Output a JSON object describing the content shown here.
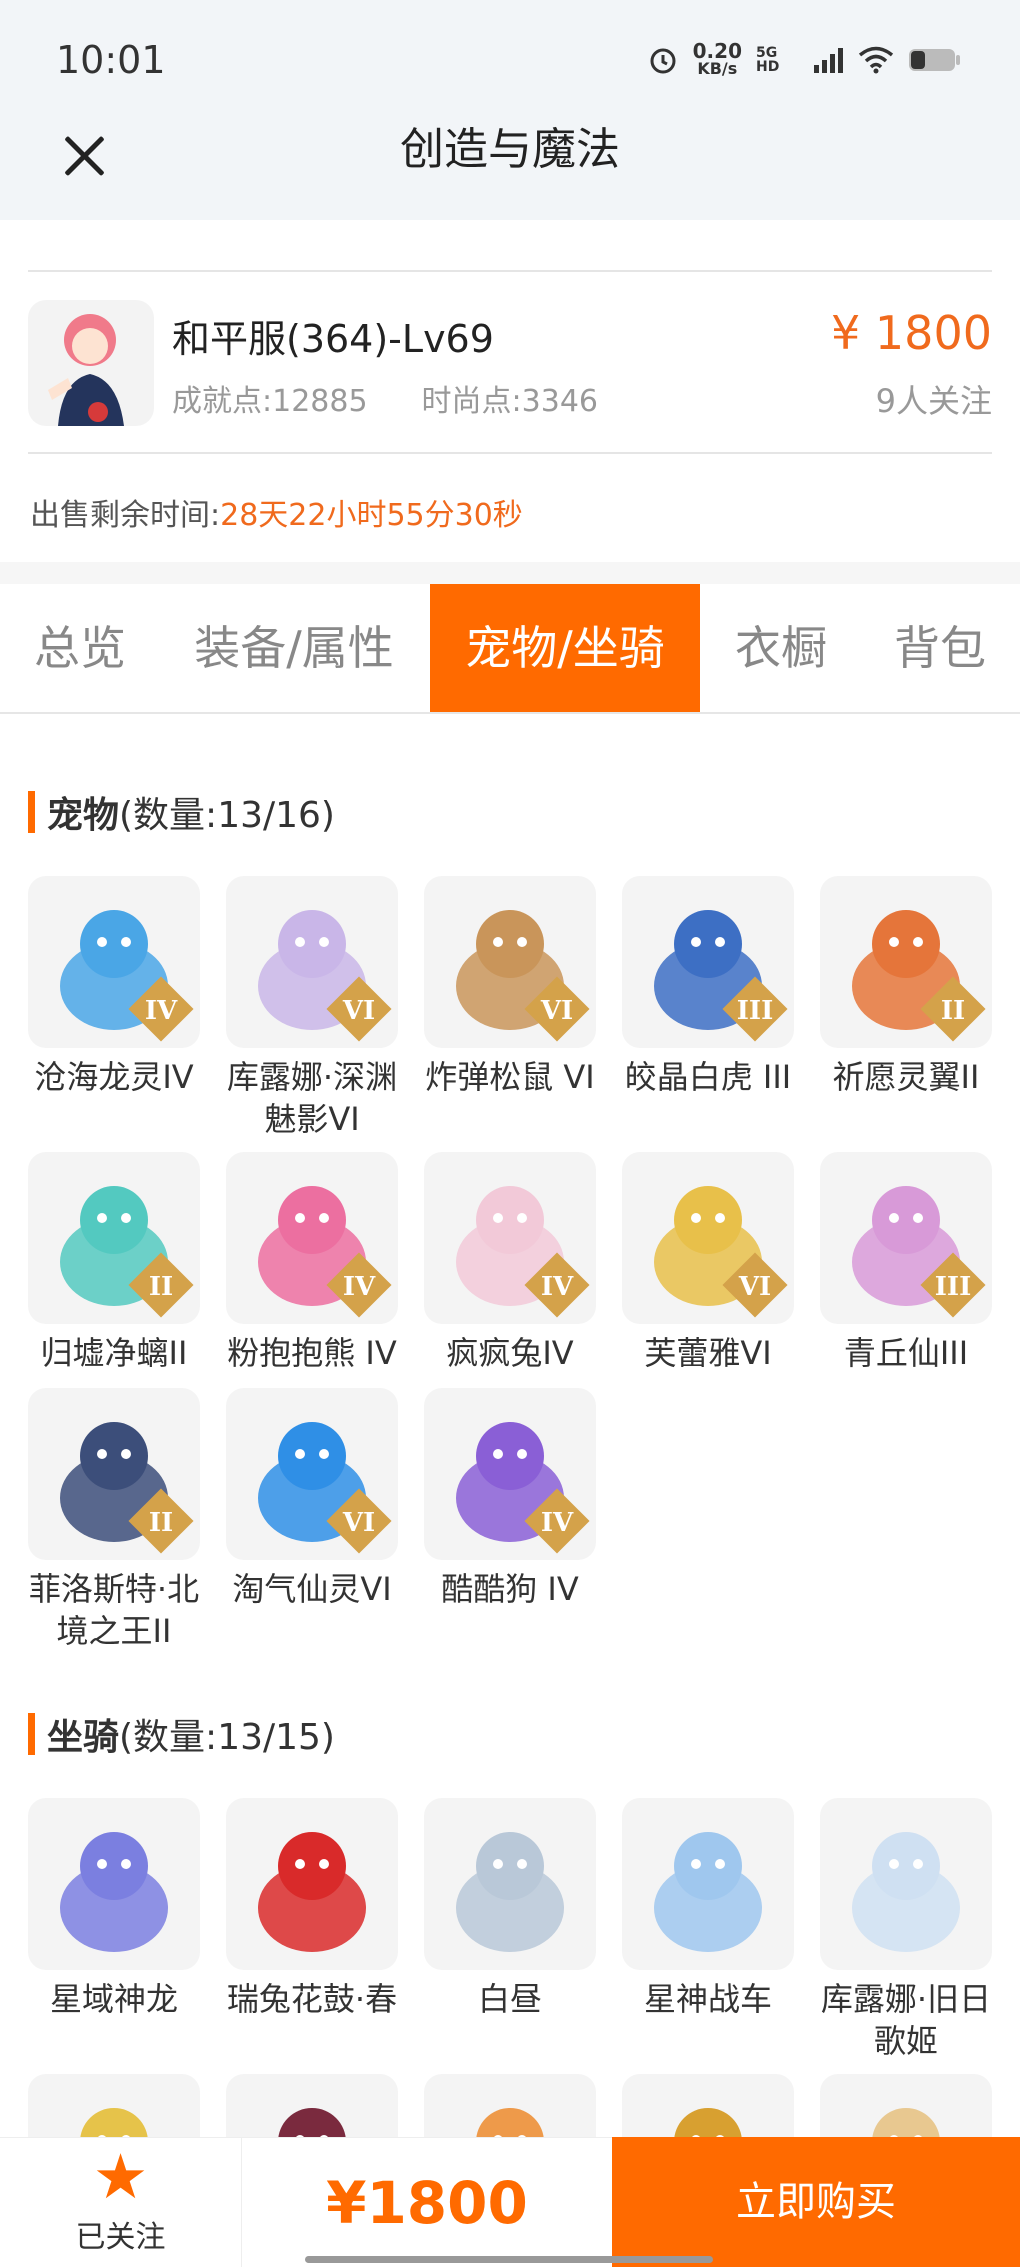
{
  "status_bar": {
    "time": "10:01",
    "net_speed": "0.20",
    "net_unit": "KB/s",
    "signal": "5G HD"
  },
  "nav": {
    "title": "创造与魔法"
  },
  "product": {
    "name": "和平服(364)-Lv69",
    "achievement": "成就点:12885",
    "fashion": "时尚点:3346",
    "price": "¥ 1800",
    "followers": "9人关注",
    "remaining_label": "出售剩余时间:",
    "remaining_value": "28天22小时55分30秒"
  },
  "tabs": [
    {
      "label": "总览"
    },
    {
      "label": "装备/属性"
    },
    {
      "label": "宠物/坐骑",
      "active": true
    },
    {
      "label": "衣橱"
    },
    {
      "label": "背包"
    }
  ],
  "pets": {
    "title": "宠物",
    "count": "(数量:13/16)",
    "items": [
      {
        "name": "沧海龙灵IV",
        "badge": "IV",
        "color": "#4aa6e6"
      },
      {
        "name": "库露娜·深渊魅影VI",
        "badge": "VI",
        "color": "#c9b6e8"
      },
      {
        "name": "炸弹松鼠 VI",
        "badge": "VI",
        "color": "#c9955a"
      },
      {
        "name": "皎晶白虎 III",
        "badge": "III",
        "color": "#3d6fc4"
      },
      {
        "name": "祈愿灵翼II",
        "badge": "II",
        "color": "#e5753a"
      },
      {
        "name": "归墟净螭II",
        "badge": "II",
        "color": "#53c9c0"
      },
      {
        "name": "粉抱抱熊 IV",
        "badge": "IV",
        "color": "#ec6fa0"
      },
      {
        "name": "疯疯兔IV",
        "badge": "IV",
        "color": "#f2c9d8"
      },
      {
        "name": "芙蕾雅VI",
        "badge": "VI",
        "color": "#e8c04a"
      },
      {
        "name": "青丘仙III",
        "badge": "III",
        "color": "#d89ad8"
      },
      {
        "name": "菲洛斯特·北境之王II",
        "badge": "II",
        "color": "#3c4e7a"
      },
      {
        "name": "淘气仙灵VI",
        "badge": "VI",
        "color": "#2f8fe6"
      },
      {
        "name": "酷酷狗 IV",
        "badge": "IV",
        "color": "#8a5fd6"
      }
    ]
  },
  "mounts": {
    "title": "坐骑",
    "count": "(数量:13/15)",
    "items": [
      {
        "name": "星域神龙",
        "color": "#7b7fe0"
      },
      {
        "name": "瑞兔花鼓·春",
        "color": "#d92a2a"
      },
      {
        "name": "白昼",
        "color": "#b9c8d8"
      },
      {
        "name": "星神战车",
        "color": "#9fc7ee"
      },
      {
        "name": "库露娜·旧日歌姬",
        "color": "#cfe0f2"
      },
      {
        "name": "",
        "color": "#e6c34a"
      },
      {
        "name": "",
        "color": "#7a2a3e"
      },
      {
        "name": "",
        "color": "#ee9a4a"
      },
      {
        "name": "",
        "color": "#d8a030"
      },
      {
        "name": "",
        "color": "#e8c890"
      }
    ]
  },
  "bottom": {
    "follow_label": "已关注",
    "total_price": "¥1800",
    "buy_label": "立即购买"
  },
  "colors": {
    "accent": "#ff6a00",
    "price": "#f06a1d"
  }
}
